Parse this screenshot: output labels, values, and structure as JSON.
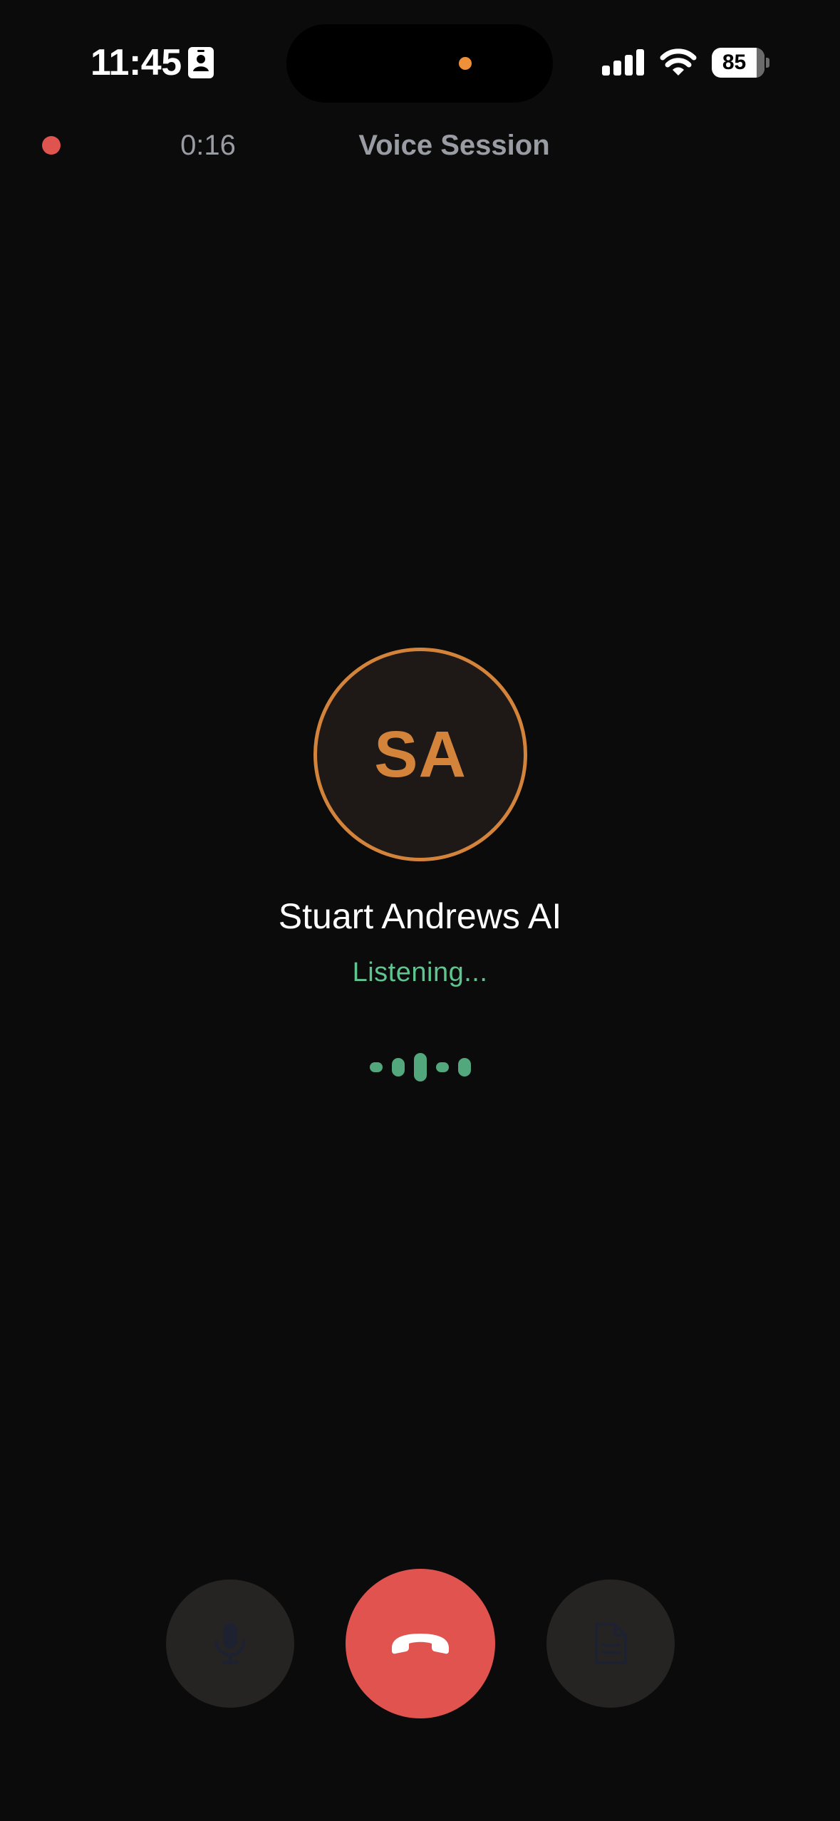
{
  "status_bar": {
    "time": "11:45",
    "battery_level": "85",
    "icons": [
      "contact-card-icon",
      "cellular-signal-icon",
      "wifi-icon",
      "battery-icon"
    ]
  },
  "session": {
    "recording": true,
    "elapsed": "0:16",
    "title": "Voice Session"
  },
  "caller": {
    "initials": "SA",
    "name": "Stuart Andrews AI",
    "status": "Listening..."
  },
  "voice_activity": {
    "levels": [
      0.35,
      0.65,
      1.0,
      0.35,
      0.65
    ]
  },
  "controls": {
    "mute": {
      "icon": "microphone-icon",
      "enabled": false
    },
    "end_call": {
      "icon": "hang-up-icon"
    },
    "notes": {
      "icon": "document-icon",
      "enabled": false
    }
  },
  "colors": {
    "background": "#0b0b0b",
    "accent": "#d4843a",
    "listening": "#5ec590",
    "end_call": "#e0534f",
    "recording": "#e05450",
    "muted_text": "#9a9ca3"
  }
}
